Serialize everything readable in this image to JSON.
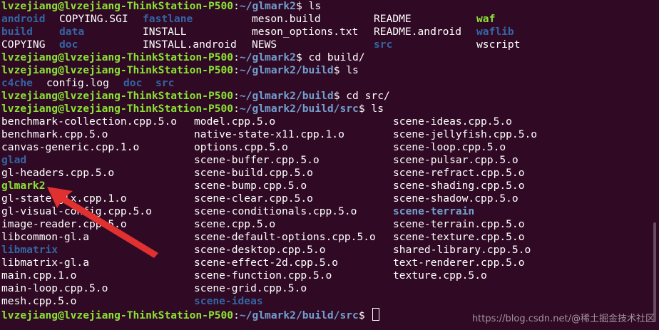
{
  "colors": {
    "background": "#300a24",
    "prompt_user": "#8ae234",
    "prompt_path": "#729fcf",
    "directory": "#3465a4",
    "executable": "#8ae234",
    "arrow": "#e03030"
  },
  "prompt_sep": ":",
  "prompt_sign": "$",
  "lines": [
    {
      "type": "prompt",
      "user": "lvzejiang@lvzejiang-ThinkStation-P500",
      "path": "~/glmark2",
      "cmd": " ls"
    },
    {
      "type": "cols",
      "items": [
        {
          "t": "android",
          "k": "dir"
        },
        {
          "t": "COPYING.SGI",
          "k": "file"
        },
        {
          "t": "fastlane",
          "k": "dir"
        },
        {
          "t": "meson.build",
          "k": "file"
        },
        {
          "t": "README",
          "k": "file"
        },
        {
          "t": "waf",
          "k": "exec"
        }
      ]
    },
    {
      "type": "cols",
      "items": [
        {
          "t": "build",
          "k": "dir"
        },
        {
          "t": "data",
          "k": "dir"
        },
        {
          "t": "INSTALL",
          "k": "file"
        },
        {
          "t": "meson_options.txt",
          "k": "file"
        },
        {
          "t": "README.android",
          "k": "file"
        },
        {
          "t": "waflib",
          "k": "dir"
        }
      ]
    },
    {
      "type": "cols",
      "items": [
        {
          "t": "COPYING",
          "k": "file"
        },
        {
          "t": "doc",
          "k": "dir"
        },
        {
          "t": "INSTALL.android",
          "k": "file"
        },
        {
          "t": "NEWS",
          "k": "file"
        },
        {
          "t": "src",
          "k": "dir"
        },
        {
          "t": "wscript",
          "k": "file"
        }
      ]
    },
    {
      "type": "prompt",
      "user": "lvzejiang@lvzejiang-ThinkStation-P500",
      "path": "~/glmark2",
      "cmd": " cd build/"
    },
    {
      "type": "prompt",
      "user": "lvzejiang@lvzejiang-ThinkStation-P500",
      "path": "~/glmark2/build",
      "cmd": " ls"
    },
    {
      "type": "cols",
      "items": [
        {
          "t": "c4che",
          "k": "dir"
        },
        {
          "t": "config.log",
          "k": "file"
        },
        {
          "t": "doc",
          "k": "dir"
        },
        {
          "t": "src",
          "k": "dir"
        }
      ]
    },
    {
      "type": "prompt",
      "user": "lvzejiang@lvzejiang-ThinkStation-P500",
      "path": "~/glmark2/build",
      "cmd": " cd src/"
    },
    {
      "type": "prompt",
      "user": "lvzejiang@lvzejiang-ThinkStation-P500",
      "path": "~/glmark2/build/src",
      "cmd": " ls"
    },
    {
      "type": "cols",
      "items": [
        {
          "t": "benchmark-collection.cpp.5.o",
          "k": "file"
        },
        {
          "t": "model.cpp.5.o",
          "k": "file"
        },
        {
          "t": "scene-ideas.cpp.5.o",
          "k": "file"
        }
      ]
    },
    {
      "type": "cols",
      "items": [
        {
          "t": "benchmark.cpp.5.o",
          "k": "file"
        },
        {
          "t": "native-state-x11.cpp.1.o",
          "k": "file"
        },
        {
          "t": "scene-jellyfish.cpp.5.o",
          "k": "file"
        }
      ]
    },
    {
      "type": "cols",
      "items": [
        {
          "t": "canvas-generic.cpp.1.o",
          "k": "file"
        },
        {
          "t": "options.cpp.5.o",
          "k": "file"
        },
        {
          "t": "scene-loop.cpp.5.o",
          "k": "file"
        }
      ]
    },
    {
      "type": "cols",
      "items": [
        {
          "t": "glad",
          "k": "dir"
        },
        {
          "t": "scene-buffer.cpp.5.o",
          "k": "file"
        },
        {
          "t": "scene-pulsar.cpp.5.o",
          "k": "file"
        }
      ]
    },
    {
      "type": "cols",
      "items": [
        {
          "t": "gl-headers.cpp.5.o",
          "k": "file"
        },
        {
          "t": "scene-build.cpp.5.o",
          "k": "file"
        },
        {
          "t": "scene-refract.cpp.5.o",
          "k": "file"
        }
      ]
    },
    {
      "type": "cols",
      "items": [
        {
          "t": "glmark2",
          "k": "exec"
        },
        {
          "t": "scene-bump.cpp.5.o",
          "k": "file"
        },
        {
          "t": "scene-shading.cpp.5.o",
          "k": "file"
        }
      ]
    },
    {
      "type": "cols",
      "items": [
        {
          "t": "gl-state-glx.cpp.1.o",
          "k": "file"
        },
        {
          "t": "scene-clear.cpp.5.o",
          "k": "file"
        },
        {
          "t": "scene-shadow.cpp.5.o",
          "k": "file"
        }
      ]
    },
    {
      "type": "cols",
      "items": [
        {
          "t": "gl-visual-config.cpp.5.o",
          "k": "file"
        },
        {
          "t": "scene-conditionals.cpp.5.o",
          "k": "file"
        },
        {
          "t": "scene-terrain",
          "k": "dirhl"
        }
      ]
    },
    {
      "type": "cols",
      "items": [
        {
          "t": "image-reader.cpp.5.o",
          "k": "file"
        },
        {
          "t": "scene.cpp.5.o",
          "k": "file"
        },
        {
          "t": "scene-terrain.cpp.5.o",
          "k": "file"
        }
      ]
    },
    {
      "type": "cols",
      "items": [
        {
          "t": "libcommon-gl.a",
          "k": "file"
        },
        {
          "t": "scene-default-options.cpp.5.o",
          "k": "file"
        },
        {
          "t": "scene-texture.cpp.5.o",
          "k": "file"
        }
      ]
    },
    {
      "type": "cols",
      "items": [
        {
          "t": "libmatrix",
          "k": "dir"
        },
        {
          "t": "scene-desktop.cpp.5.o",
          "k": "file"
        },
        {
          "t": "shared-library.cpp.5.o",
          "k": "file"
        }
      ]
    },
    {
      "type": "cols",
      "items": [
        {
          "t": "libmatrix-gl.a",
          "k": "file"
        },
        {
          "t": "scene-effect-2d.cpp.5.o",
          "k": "file"
        },
        {
          "t": "text-renderer.cpp.5.o",
          "k": "file"
        }
      ]
    },
    {
      "type": "cols",
      "items": [
        {
          "t": "main.cpp.1.o",
          "k": "file"
        },
        {
          "t": "scene-function.cpp.5.o",
          "k": "file"
        },
        {
          "t": "texture.cpp.5.o",
          "k": "file"
        }
      ]
    },
    {
      "type": "cols",
      "items": [
        {
          "t": "main-loop.cpp.5.o",
          "k": "file"
        },
        {
          "t": "scene-grid.cpp.5.o",
          "k": "file"
        }
      ]
    },
    {
      "type": "cols",
      "items": [
        {
          "t": "mesh.cpp.5.o",
          "k": "file"
        },
        {
          "t": "scene-ideas",
          "k": "dir"
        }
      ]
    },
    {
      "type": "prompt",
      "user": "lvzejiang@lvzejiang-ThinkStation-P500",
      "path": "~/glmark2/build/src",
      "cmd": " ",
      "cursor": true
    }
  ],
  "watermark": "https://blog.csdn.net/@稀土掘金技术社区"
}
